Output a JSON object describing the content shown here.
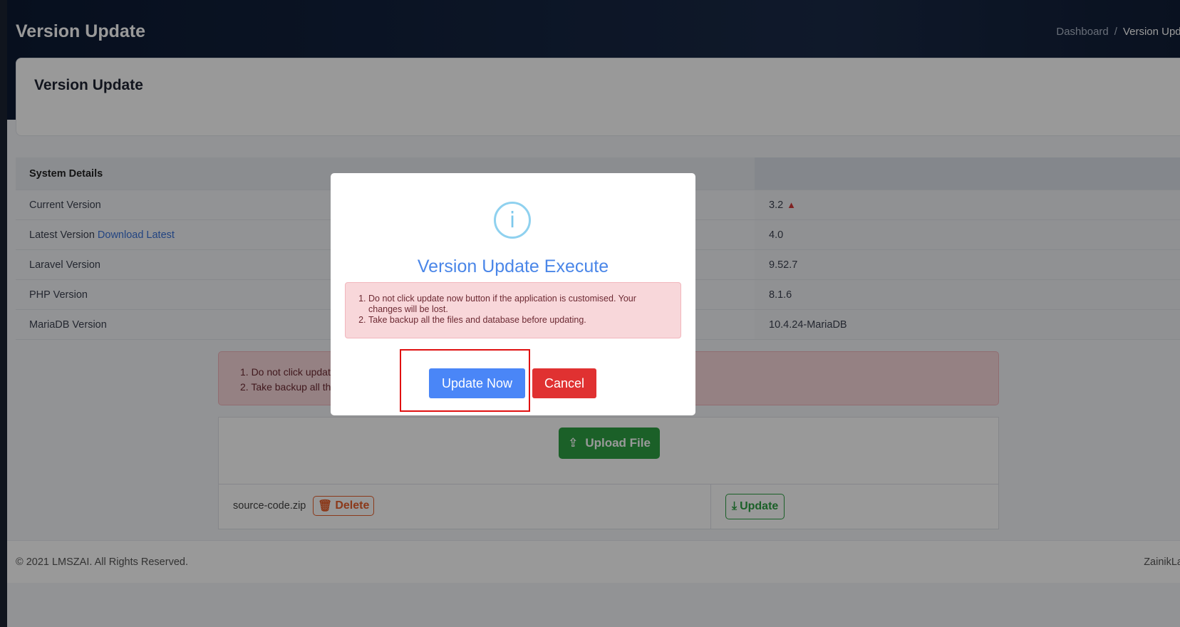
{
  "header": {
    "title": "Version Update",
    "breadcrumb": {
      "home": "Dashboard",
      "separator": "/",
      "current": "Version Upda"
    }
  },
  "card": {
    "title": "Version Update"
  },
  "system_table": {
    "header_label": "System Details",
    "rows": [
      {
        "label": "Current Version",
        "value": "3.2",
        "warning": true
      },
      {
        "label": "Latest Version",
        "link": "Download Latest",
        "value": "4.0"
      },
      {
        "label": "Laravel Version",
        "value": "9.52.7"
      },
      {
        "label": "PHP Version",
        "value": "8.1.6"
      },
      {
        "label": "MariaDB Version",
        "value": "10.4.24-MariaDB"
      }
    ]
  },
  "page_alert": {
    "items": [
      "1. Do not click updat",
      "2. Take backup all th"
    ]
  },
  "upload": {
    "upload_label": "Upload File",
    "file_name": "source-code.zip",
    "delete_label": "Delete",
    "update_label": "Update"
  },
  "footer": {
    "copyright": "© 2021 LMSZAI. All Rights Reserved.",
    "credit": "ZainikLa"
  },
  "modal": {
    "icon": "info-icon",
    "icon_glyph": "i",
    "title": "Version Update Execute",
    "alert_items": [
      "Do not click update now button if the application is customised. Your changes will be lost.",
      "Take backup all the files and database before updating."
    ],
    "confirm_label": "Update Now",
    "cancel_label": "Cancel"
  },
  "colors": {
    "primary": "#4a86f7",
    "danger": "#e03131",
    "success": "#2ea043",
    "highlight": "#e01010"
  }
}
